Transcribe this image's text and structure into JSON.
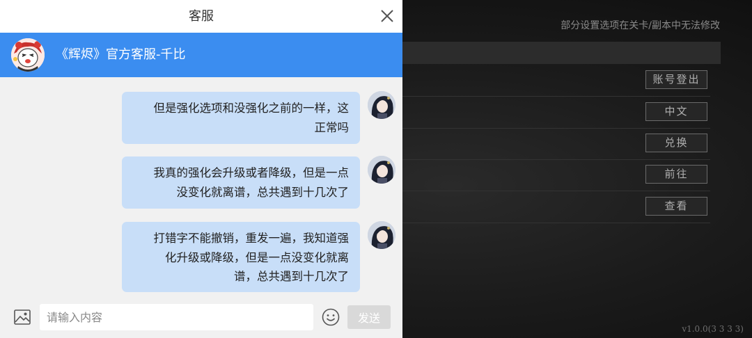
{
  "background": {
    "notice": "部分设置选项在关卡/副本中无法修改",
    "buttons": [
      {
        "label": "账号登出"
      },
      {
        "label": "中文"
      },
      {
        "label": "兑换"
      },
      {
        "label": "前往"
      },
      {
        "label": "查看"
      }
    ],
    "version": "v1.0.0(3 3 3 3)"
  },
  "chat": {
    "title": "客服",
    "agent_name": "《辉烬》官方客服-千比",
    "messages": [
      {
        "lines": [
          "但是强化选项和没强化之前的一样，这",
          "正常吗"
        ]
      },
      {
        "lines": [
          "我真的强化会升级或者降级，但是一点",
          "没变化就离谱，总共遇到十几次了"
        ]
      },
      {
        "lines": [
          "打错字不能撤销，重发一遍，我知道强",
          "化升级或降级，但是一点没变化就离",
          "谱，总共遇到十几次了"
        ]
      }
    ],
    "input": {
      "placeholder": "请输入内容",
      "value": ""
    },
    "send_label": "发送"
  },
  "colors": {
    "agent_bar": "#3b8df0",
    "bubble": "#c8def8",
    "send_disabled": "#d9d9d9"
  },
  "icons": [
    "close-icon",
    "image-icon",
    "emoji-icon"
  ]
}
